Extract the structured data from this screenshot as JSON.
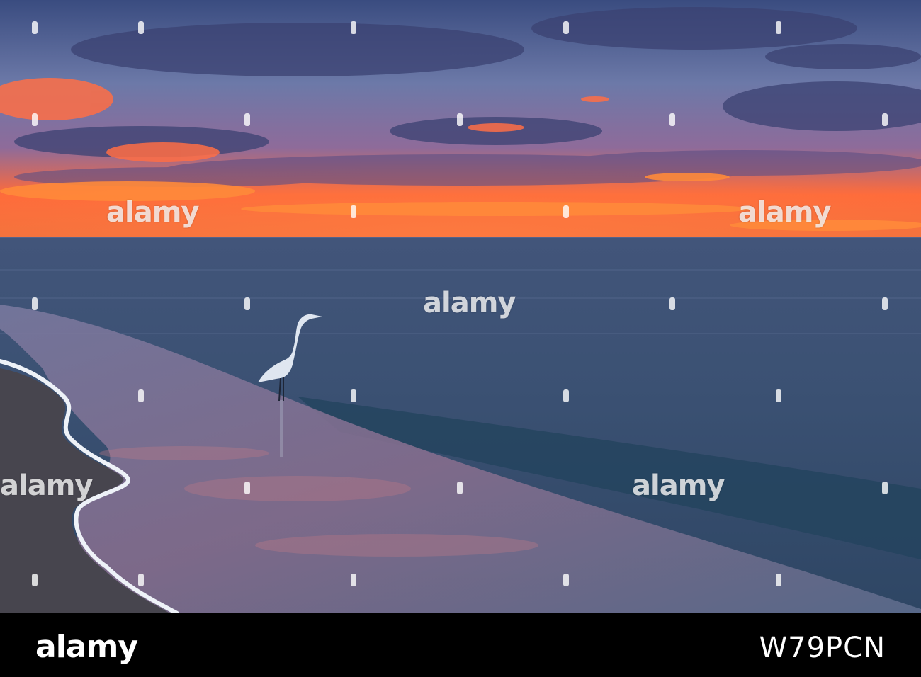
{
  "photo": {
    "subject": "heron-wading-at-sunset-beach",
    "colors": {
      "sky_top": "#3c4f86",
      "sky_glow": "#ff6a3d",
      "sea": "#3b4e74",
      "sand": "#4a4852",
      "foam": "#e8edf5",
      "bird": "#dfe6f0"
    }
  },
  "watermark": {
    "text": "alamy"
  },
  "footer": {
    "logo": "alamy",
    "image_id": "W79PCN"
  }
}
